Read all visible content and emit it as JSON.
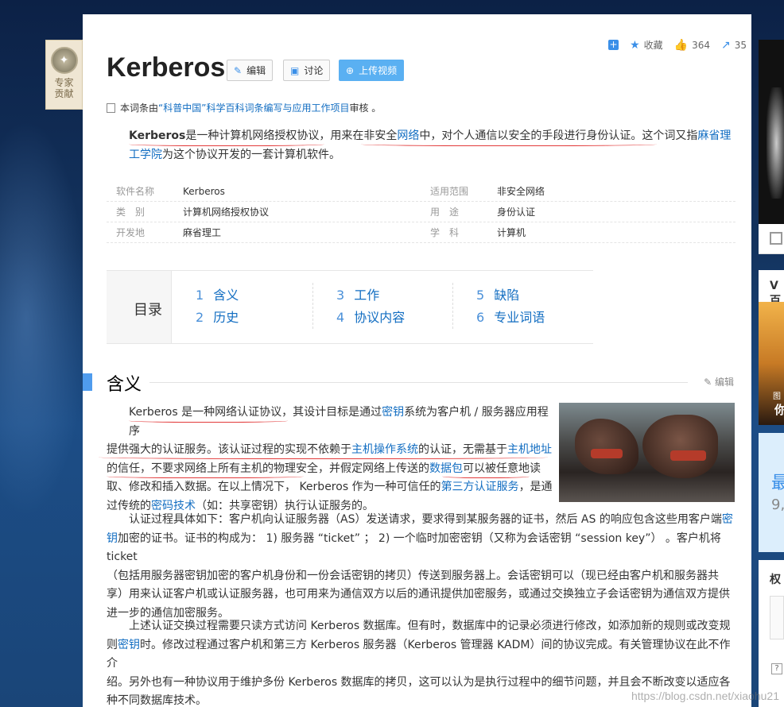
{
  "expert_badge": {
    "line1": "专家",
    "line2": "贡献"
  },
  "topbar": {
    "favorite_label": "收藏",
    "like_count": "364",
    "share_count": "35"
  },
  "title": "Kerberos",
  "buttons": {
    "edit": "编辑",
    "discuss": "讨论",
    "upload_video": "上传视频"
  },
  "review": {
    "prefix": "本词条由",
    "link": "“科普中国”科学百科词条编写与应用工作项目",
    "suffix": " 审核 。"
  },
  "lead": {
    "term": "Kerberos",
    "t1": "是一种计算机网络授权协议，用来在非安全",
    "link1": "网络",
    "t2": "中，对个人通信以安全的手段进行身份认证。这个词又指",
    "link2": "麻省理工学院",
    "t3": "为这个协议开发的一套计算机软件。"
  },
  "infobox": [
    {
      "k1": "软件名称",
      "v1": "Kerberos",
      "k2": "适用范围",
      "v2": "非安全网络"
    },
    {
      "k1": "类　别",
      "v1": "计算机网络授权协议",
      "k2": "用　途",
      "v2": "身份认证"
    },
    {
      "k1": "开发地",
      "v1": "麻省理工",
      "k2": "学　科",
      "v2": "计算机"
    }
  ],
  "toc": {
    "title": "目录",
    "items": [
      {
        "num": "1",
        "label": "含义"
      },
      {
        "num": "2",
        "label": "历史"
      },
      {
        "num": "3",
        "label": "工作"
      },
      {
        "num": "4",
        "label": "协议内容"
      },
      {
        "num": "5",
        "label": "缺陷"
      },
      {
        "num": "6",
        "label": "专业词语"
      }
    ]
  },
  "section": {
    "title": "含义",
    "edit": "编辑"
  },
  "para1": {
    "l1a": "Kerberos 是一种网络认证协议，其设计目标是通过",
    "l1link": "密钥",
    "l1b": "系统为客户机 / 服务器应用程序",
    "l2a": "提供强大的认证服务。该认证过程的实现不依赖于",
    "l2link1": "主机操作系统",
    "l2b": "的认证，无需基于",
    "l2link2": "主机地址",
    "l3a": "的信任，不要求网络上所有主机的物理安全，并假定网络上传送的",
    "l3link": "数据包",
    "l3b": "可以被任意地读",
    "l4a": "取、修改和插入数据。在以上情况下， Kerberos 作为一种可信任的",
    "l4link": "第三方认证服务",
    "l4b": "，是通",
    "l5a": "过传统的",
    "l5link": "密码技术",
    "l5b": "（如：共享密钥）执行认证服务的。"
  },
  "para2": {
    "l1": "认证过程具体如下：客户机向认证服务器（AS）发送请求，要求得到某服务器的证书，然后 AS 的响应包含这些用客户端",
    "l1link": "密",
    "l2link": "钥",
    "l2": "加密的证书。证书的构成为： 1) 服务器 “ticket” ； 2) 一个临时加密密钥（又称为会话密钥 “session key”） 。客户机将 ticket",
    "l3": "（包括用服务器密钥加密的客户机身份和一份会话密钥的拷贝）传送到服务器上。会话密钥可以（现已经由客户机和服务器共",
    "l4": "享）用来认证客户机或认证服务器，也可用来为通信双方以后的通讯提供加密服务，或通过交换独立子会话密钥为通信双方提供",
    "l5": "进一步的通信加密服务。"
  },
  "para3": {
    "l1": "上述认证交换过程需要只读方式访问 Kerberos 数据库。但有时，数据库中的记录必须进行修改，如添加新的规则或改变规",
    "l2a": "则",
    "l2link": "密钥",
    "l2b": "时。修改过程通过客户机和第三方 Kerberos 服务器（Kerberos 管理器 KADM）间的协议完成。有关管理协议在此不作介",
    "l3": "绍。另外也有一种协议用于维护多份 Kerberos 数据库的拷贝，这可以认为是执行过程中的细节问题，并且会不断改变以适应各",
    "l4": "种不同数据库技术。"
  },
  "right": {
    "card_title": "V百",
    "img_caption": "图",
    "img_caption2": "你",
    "blue_a": "最",
    "blue_b": "9,",
    "card2_title": "权",
    "help": "?"
  },
  "watermark": "https://blog.csdn.net/xiaohu21"
}
